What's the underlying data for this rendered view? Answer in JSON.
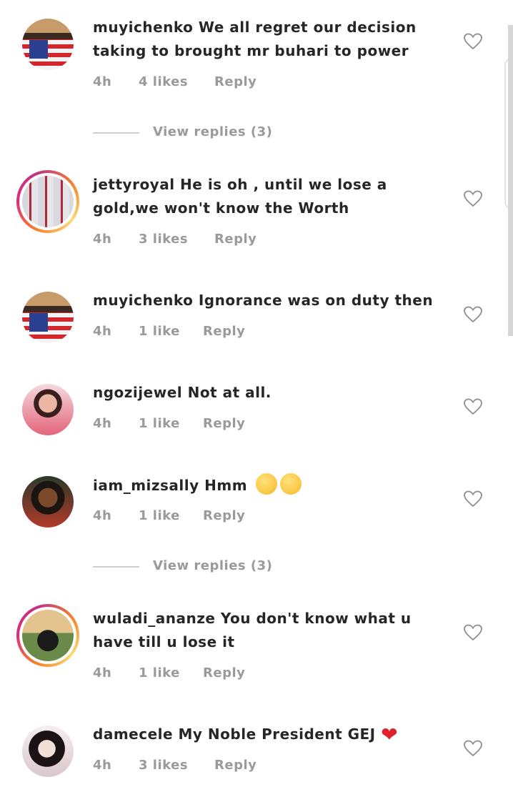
{
  "comments": [
    {
      "user": "muyichenko",
      "text": "We all regret our decision taking to brought mr buhari to power",
      "time": "4h",
      "likes": "4 likes",
      "reply": "Reply",
      "avatar": "flag-shirt-man"
    },
    {
      "user": "jettyroyal",
      "text": "He is oh , until we lose a gold,we won't know the Worth",
      "time": "4h",
      "likes": "3 likes",
      "reply": "Reply",
      "avatar": "boxes",
      "story_ring": true
    },
    {
      "user": "muyichenko",
      "text": "Ignorance was on duty then",
      "time": "4h",
      "likes": "1 like",
      "reply": "Reply",
      "avatar": "flag-shirt-man"
    },
    {
      "user": "ngozijewel",
      "text": "Not at all.",
      "time": "4h",
      "likes": "1 like",
      "reply": "Reply",
      "avatar": "woman-pink"
    },
    {
      "user": "iam_mizsally",
      "text": "Hmm",
      "time": "4h",
      "likes": "1 like",
      "reply": "Reply",
      "avatar": "woman-smiling",
      "emojis": [
        "crying-face-emoji",
        "crying-face-emoji"
      ]
    },
    {
      "user": "wuladi_ananze",
      "text": "You don't know what u have till u lose it",
      "time": "4h",
      "likes": "1 like",
      "reply": "Reply",
      "avatar": "man-outdoor",
      "story_ring": true
    },
    {
      "user": "damecele",
      "text": "My Noble President GEJ",
      "time": "4h",
      "likes": "3 likes",
      "reply": "Reply",
      "avatar": "woman-glam",
      "emojis": [
        "red-heart-emoji"
      ]
    }
  ],
  "view_replies": [
    "View replies (3)",
    "View replies (3)"
  ],
  "colors": {
    "text": "#262626",
    "meta": "#9a9a9a",
    "ring_start": "#f58529",
    "ring_end": "#dd2a7b",
    "heart_emoji": "#e0202a"
  }
}
